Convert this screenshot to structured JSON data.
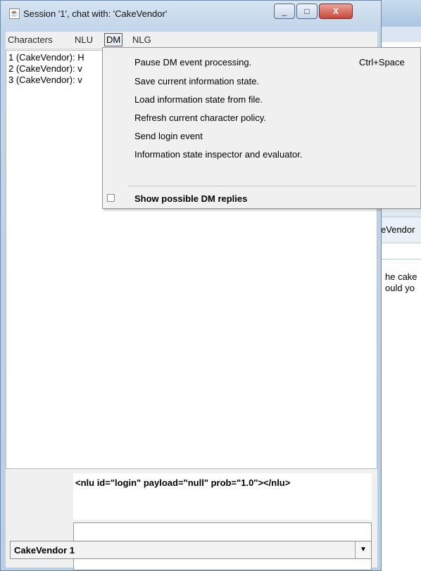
{
  "window": {
    "title": "Session '1', chat with: 'CakeVendor'",
    "minimize_glyph": "_",
    "maximize_glyph": "□",
    "close_glyph": "X"
  },
  "menubar": {
    "characters": "Characters",
    "nlu": "NLU",
    "dm": "DM",
    "nlg": "NLG"
  },
  "chat": {
    "lines": [
      "1 (CakeVendor): H",
      "2 (CakeVendor): v",
      "3 (CakeVendor): v"
    ]
  },
  "dm_menu": {
    "items": [
      {
        "label": "Pause DM event processing.",
        "shortcut": "Ctrl+Space"
      },
      {
        "label": "Save current information state."
      },
      {
        "label": "Load information state from file."
      },
      {
        "label": "Refresh current character policy."
      },
      {
        "label": "Send login event"
      },
      {
        "label": "Information state inspector and evaluator."
      }
    ],
    "checkbox_item": {
      "label": "Show possible DM replies",
      "checked": false
    }
  },
  "nlu_output": "<nlu id=\"login\" payload=\"null\" prob=\"1.0\"></nlu>",
  "input": {
    "value": ""
  },
  "character_select": {
    "value": "CakeVendor 1",
    "arrow": "▼"
  },
  "background_window": {
    "tab_label": "eVendor",
    "line1": "he cake",
    "line2": "ould yo"
  }
}
